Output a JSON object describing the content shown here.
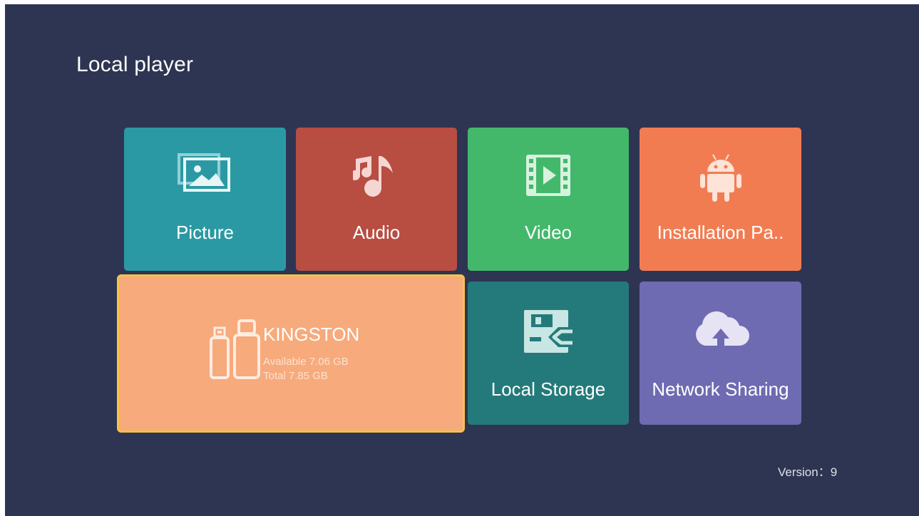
{
  "app": {
    "title": "Local player"
  },
  "tiles": {
    "picture": {
      "label": "Picture",
      "icon": "picture-icon",
      "color": "#2b99a3"
    },
    "audio": {
      "label": "Audio",
      "icon": "music-note-icon",
      "color": "#b84d42"
    },
    "video": {
      "label": "Video",
      "icon": "film-play-icon",
      "color": "#43b86b"
    },
    "apk": {
      "label": "Installation Pa..",
      "icon": "android-icon",
      "color": "#f27c52"
    },
    "usb": {
      "name": "KINGSTON",
      "available": "Available 7.06 GB",
      "total": "Total 7.85 GB",
      "icon": "usb-drive-icon",
      "color": "#f7aa7c",
      "focus_border": "#f6c34a",
      "selected": true
    },
    "local_storage": {
      "label": "Local Storage",
      "icon": "floppy-disk-icon",
      "color": "#247a7a"
    },
    "network_sharing": {
      "label": "Network Sharing",
      "icon": "cloud-upload-icon",
      "color": "#6e6bb2"
    }
  },
  "footer": {
    "version": "Version：9"
  },
  "colors": {
    "background": "#2e3552"
  }
}
